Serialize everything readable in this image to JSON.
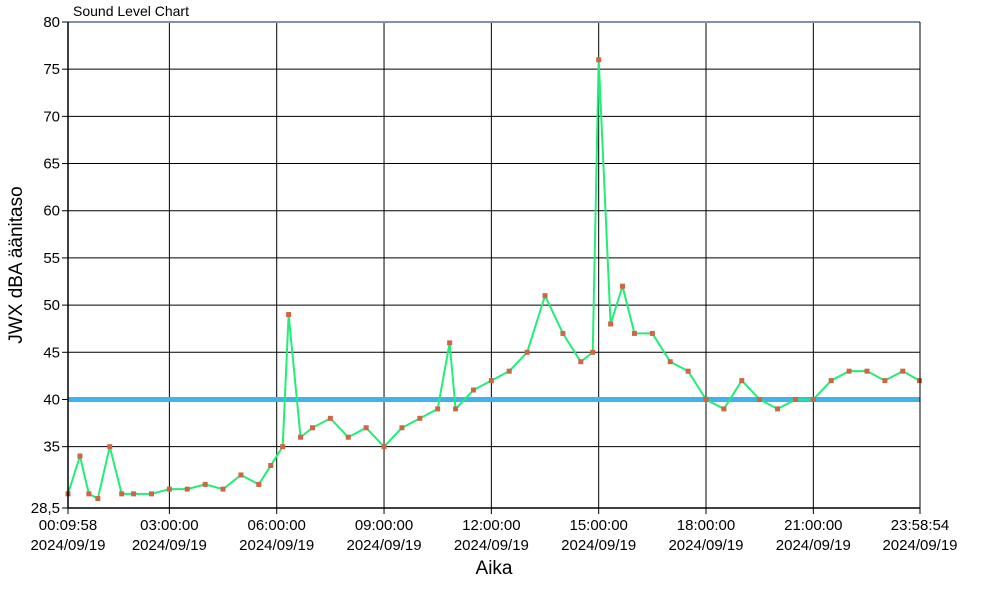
{
  "chart_data": {
    "type": "line",
    "title": "Sound Level Chart",
    "xlabel": "Aika",
    "ylabel": "JWX dBA äänitaso",
    "ylim": [
      28.5,
      80
    ],
    "xlim": [
      "2024/09/19 00:09:58",
      "2024/09/19 23:58:54"
    ],
    "grid": true,
    "y_ticks": [
      "28,5",
      "35",
      "40",
      "45",
      "50",
      "55",
      "60",
      "65",
      "70",
      "75",
      "80"
    ],
    "x_ticks": [
      {
        "time": "00:09:58",
        "date": "2024/09/19"
      },
      {
        "time": "03:00:00",
        "date": "2024/09/19"
      },
      {
        "time": "06:00:00",
        "date": "2024/09/19"
      },
      {
        "time": "09:00:00",
        "date": "2024/09/19"
      },
      {
        "time": "12:00:00",
        "date": "2024/09/19"
      },
      {
        "time": "15:00:00",
        "date": "2024/09/19"
      },
      {
        "time": "18:00:00",
        "date": "2024/09/19"
      },
      {
        "time": "21:00:00",
        "date": "2024/09/19"
      },
      {
        "time": "23:58:54",
        "date": "2024/09/19"
      }
    ],
    "reference_line": {
      "y": 40,
      "color": "#3fb4ea"
    },
    "series": [
      {
        "line_color": "#22ee77",
        "marker_color": "#cc6644",
        "x": [
          "00:10",
          "00:30",
          "00:45",
          "01:00",
          "01:20",
          "01:40",
          "02:00",
          "02:30",
          "03:00",
          "03:30",
          "04:00",
          "04:30",
          "05:00",
          "05:30",
          "05:50",
          "06:10",
          "06:20",
          "06:40",
          "07:00",
          "07:30",
          "08:00",
          "08:30",
          "09:00",
          "09:30",
          "10:00",
          "10:30",
          "10:50",
          "11:00",
          "11:30",
          "12:00",
          "12:30",
          "13:00",
          "13:30",
          "14:00",
          "14:30",
          "14:50",
          "15:00",
          "15:20",
          "15:40",
          "16:00",
          "16:30",
          "17:00",
          "17:30",
          "18:00",
          "18:30",
          "19:00",
          "19:30",
          "20:00",
          "20:30",
          "21:00",
          "21:30",
          "22:00",
          "22:30",
          "23:00",
          "23:30",
          "23:58"
        ],
        "y": [
          30,
          34,
          30,
          29.5,
          35,
          30,
          30,
          30,
          30.5,
          30.5,
          31,
          30.5,
          32,
          31,
          33,
          35,
          49,
          36,
          37,
          38,
          36,
          37,
          35,
          37,
          38,
          39,
          46,
          39,
          41,
          42,
          43,
          45,
          51,
          47,
          44,
          45,
          76,
          48,
          52,
          47,
          47,
          44,
          43,
          40,
          39,
          42,
          40,
          39,
          40,
          40,
          42,
          43,
          43,
          42,
          43,
          42
        ]
      }
    ]
  }
}
